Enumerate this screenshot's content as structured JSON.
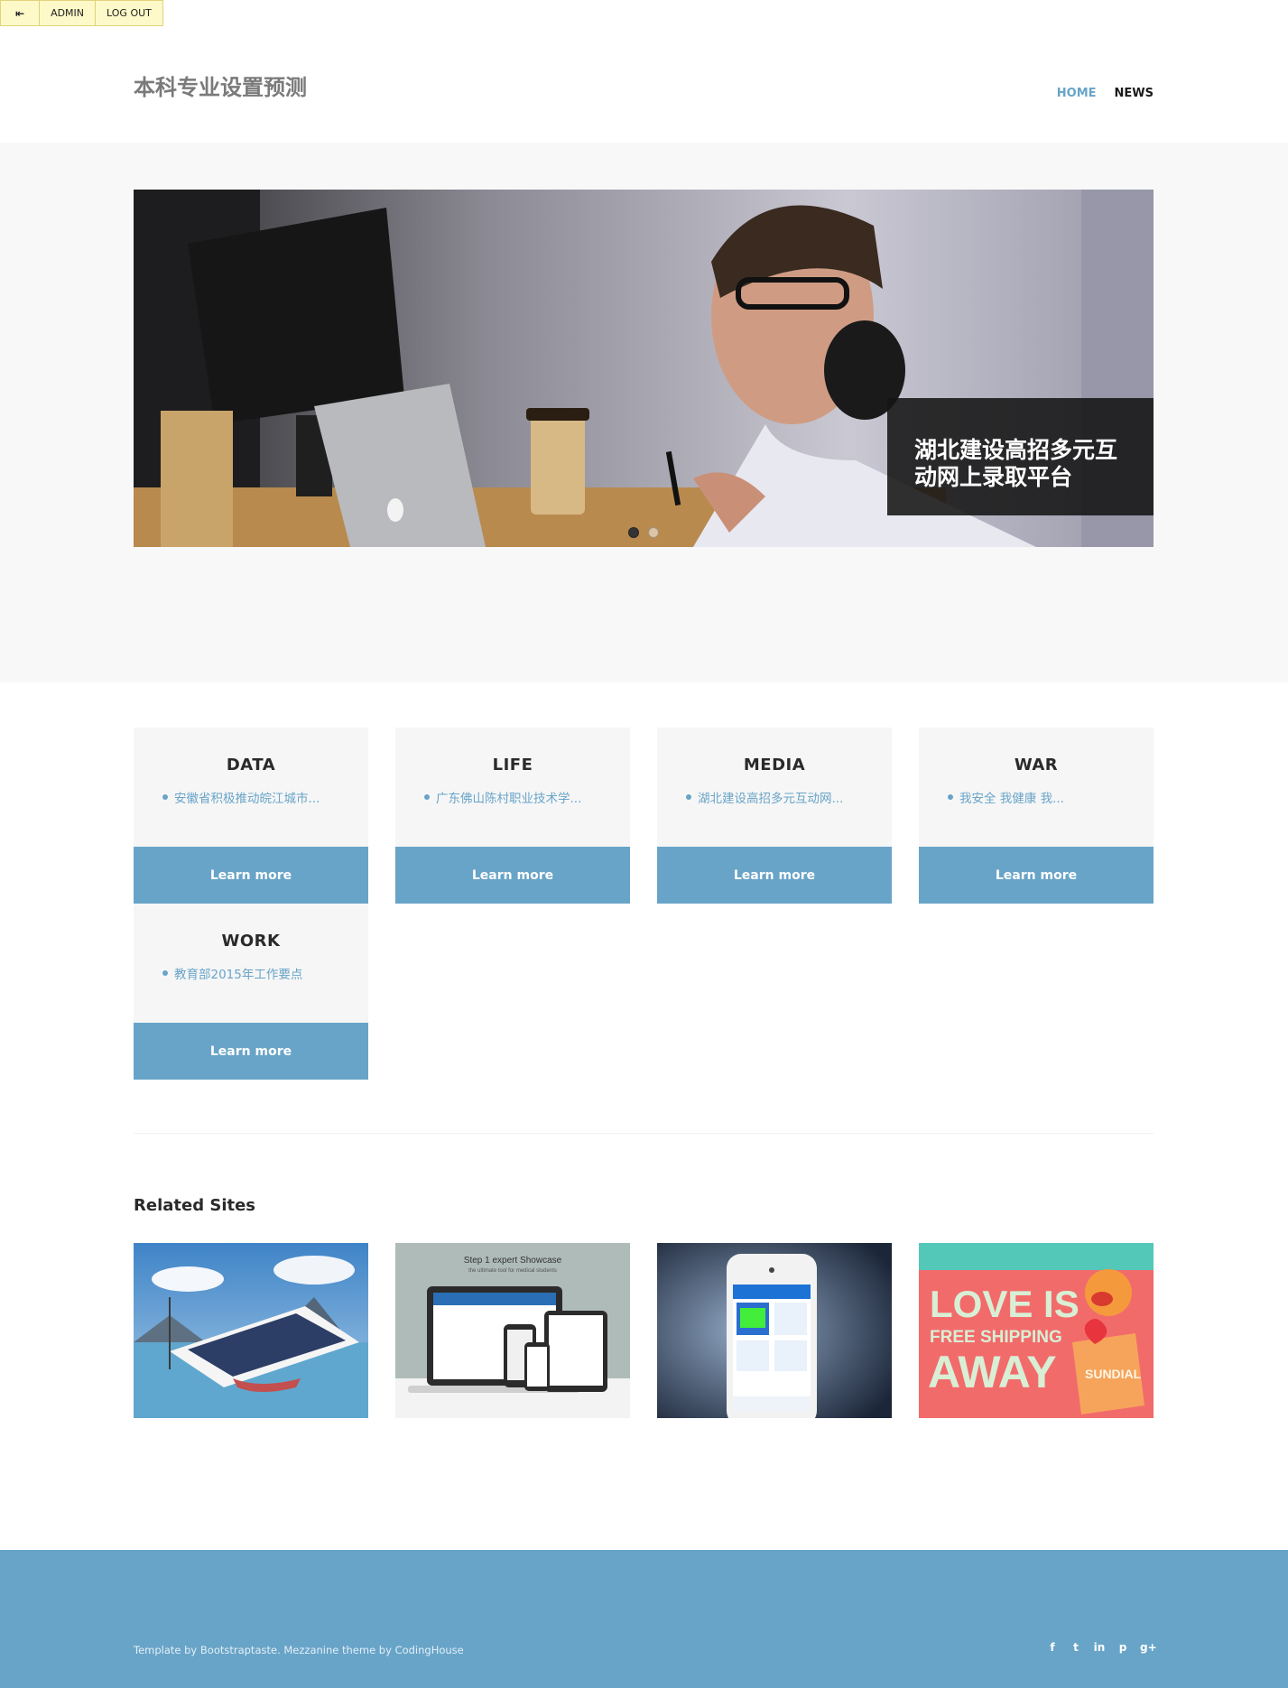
{
  "admin_bar": {
    "toggle_icon": "⇤",
    "admin_label": "ADMIN",
    "logout_label": "LOG OUT"
  },
  "header": {
    "site_title": "本科专业设置预测",
    "nav": [
      {
        "label": "HOME",
        "active": true
      },
      {
        "label": "NEWS",
        "active": false
      }
    ]
  },
  "hero": {
    "caption": "湖北建设高招多元互动网上录取平台",
    "slides": 2,
    "active_slide": 1
  },
  "categories": [
    {
      "heading": "DATA",
      "item": "安徽省积极推动皖江城市...",
      "button": "Learn more"
    },
    {
      "heading": "LIFE",
      "item": "广东佛山陈村职业技术学...",
      "button": "Learn more"
    },
    {
      "heading": "MEDIA",
      "item": "湖北建设高招多元互动网...",
      "button": "Learn more"
    },
    {
      "heading": "WAR",
      "item": "我安全 我健康 我...",
      "button": "Learn more"
    },
    {
      "heading": "WORK",
      "item": "教育部2015年工作要点",
      "button": "Learn more"
    }
  ],
  "related": {
    "title": "Related Sites",
    "thumb_texts": {
      "showcase_title": "Step 1 expert Showcase",
      "showcase_sub": "the ultimate tool for medical students",
      "love_line1": "LOVE IS",
      "love_line2": "FREE SHIPPING",
      "love_line3": "AWAY",
      "love_brand": "SUNDIAL"
    }
  },
  "footer": {
    "credit": "Template by Bootstraptaste. Mezzanine theme by CodingHouse",
    "social": [
      "f",
      "t",
      "in",
      "p",
      "g+"
    ]
  },
  "colors": {
    "accent": "#68a4c8",
    "panel": "#f6f6f6",
    "admin_bar": "#fdf9c8"
  }
}
